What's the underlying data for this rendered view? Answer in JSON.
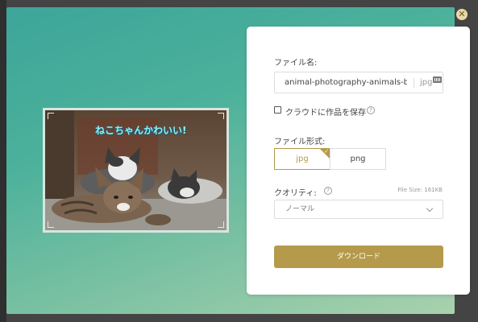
{
  "dialog": {
    "close_glyph": "✕"
  },
  "preview": {
    "caption": "ねこちゃんかわいい!"
  },
  "form": {
    "filename_label": "ファイル名:",
    "filename_value": "animal-photography-animals-bal",
    "filename_ext": "jpg",
    "save_checkbox_label": "クラウドに作品を保存",
    "save_checkbox_checked": false,
    "format_label": "ファイル形式:",
    "formats": [
      {
        "label": "jpg",
        "selected": true
      },
      {
        "label": "png",
        "selected": false
      }
    ],
    "quality_label": "クオリティ:",
    "file_size": "File Size: 161KB",
    "quality_value": "ノーマル",
    "download_label": "ダウンロード"
  },
  "colors": {
    "accent": "#b59a4c",
    "gradient_start": "#3da59a",
    "gradient_end": "#a9d1ad"
  }
}
